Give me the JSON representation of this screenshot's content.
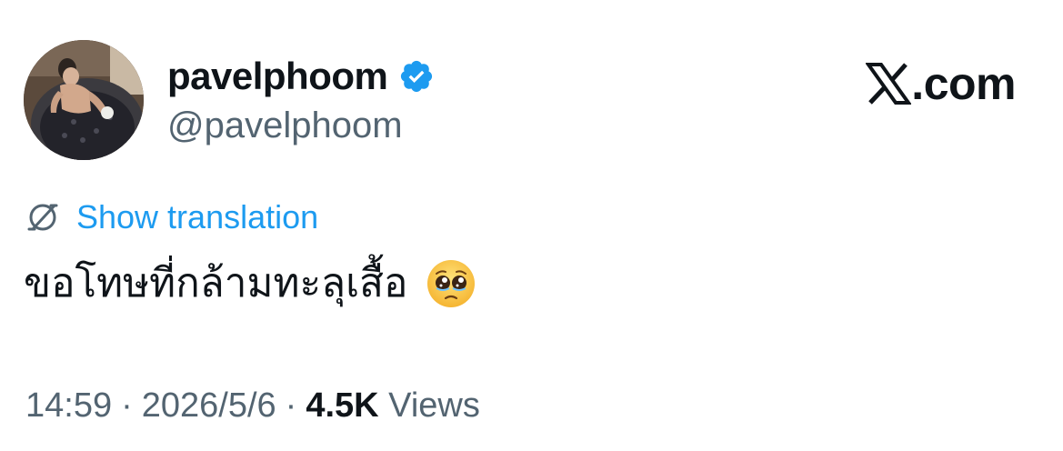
{
  "author": {
    "display_name": "pavelphoom",
    "handle": "@pavelphoom",
    "verified": true
  },
  "brand": {
    "logo_icon": "x-logo-icon",
    "suffix": ".com"
  },
  "translation": {
    "icon": "globe-icon",
    "label": "Show translation"
  },
  "tweet": {
    "text": "ขอโทษที่กล้ามทะลุเสื้อ",
    "emoji": "pleading-face-icon"
  },
  "meta": {
    "time": "14:59",
    "separator": "·",
    "date": "2026/5/6",
    "views_count": "4.5K",
    "views_label": "Views"
  },
  "colors": {
    "text_primary": "#0f1419",
    "text_secondary": "#536471",
    "link_blue": "#1d9bf0",
    "verified_blue": "#1d9bf0"
  }
}
